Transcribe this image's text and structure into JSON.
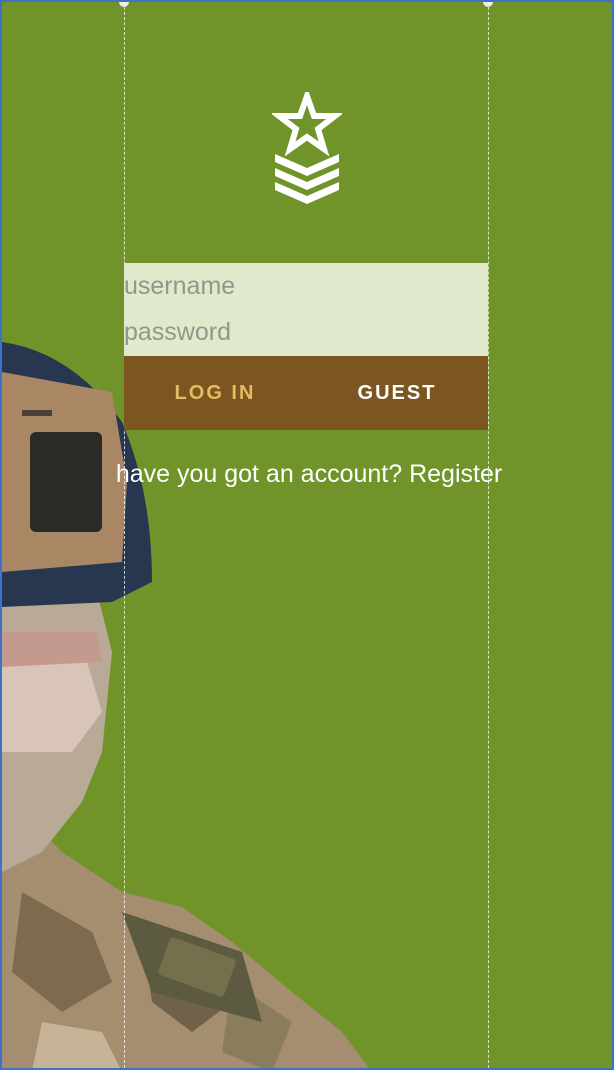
{
  "login_form": {
    "username_placeholder": "username",
    "password_placeholder": "password",
    "login_label": "LOG IN",
    "guest_label": "GUEST"
  },
  "register": {
    "prompt": "have you got an account?",
    "link_label": "Register"
  },
  "icons": {
    "logo": "military-rank-icon",
    "background_image": "soldier-photo"
  },
  "colors": {
    "background": "#709429",
    "input_panel": "#e0e9cb",
    "button_bar": "#7c5620",
    "login_text": "#e4ba62",
    "text": "#ffffff"
  }
}
